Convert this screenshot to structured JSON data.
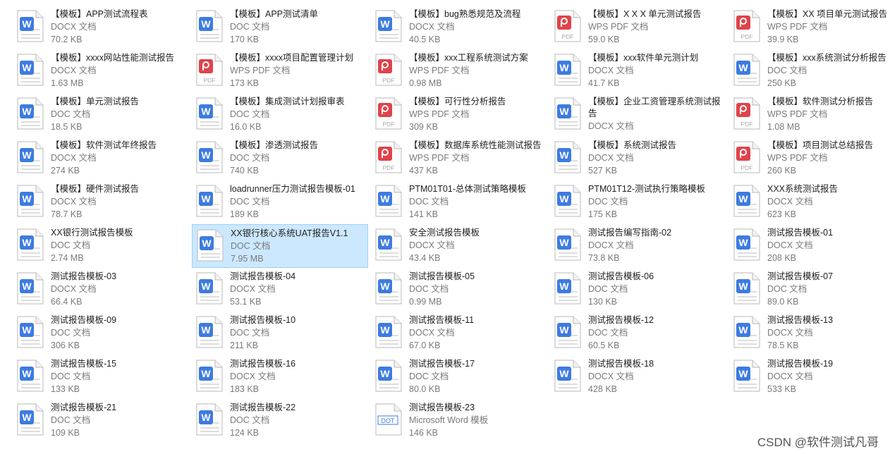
{
  "files": [
    {
      "name": "【模板】APP测试流程表",
      "type": "DOCX 文档",
      "size": "70.2 KB",
      "icon": "word-icon"
    },
    {
      "name": "【模板】APP测试清单",
      "type": "DOC 文档",
      "size": "170 KB",
      "icon": "word-icon"
    },
    {
      "name": "【模板】bug熟悉规范及流程",
      "type": "DOCX 文档",
      "size": "40.5 KB",
      "icon": "word-icon"
    },
    {
      "name": "【模板】X X X 单元测试报告",
      "type": "WPS PDF 文档",
      "size": "59.0 KB",
      "icon": "pdf-icon"
    },
    {
      "name": "【模板】XX 项目单元测试报告",
      "type": "WPS PDF 文档",
      "size": "39.9 KB",
      "icon": "pdf-icon"
    },
    {
      "name": "【模板】xxxx网站性能测试报告",
      "type": "DOCX 文档",
      "size": "1.63 MB",
      "icon": "word-icon"
    },
    {
      "name": "【模板】xxxx项目配置管理计划",
      "type": "WPS PDF 文档",
      "size": "173 KB",
      "icon": "pdf-icon"
    },
    {
      "name": "【模板】xxx工程系统测试方案",
      "type": "WPS PDF 文档",
      "size": "0.98 MB",
      "icon": "pdf-icon"
    },
    {
      "name": "【模板】xxx软件单元测计划",
      "type": "DOCX 文档",
      "size": "41.7 KB",
      "icon": "word-icon"
    },
    {
      "name": "【模板】xxx系统测试分析报告",
      "type": "DOC 文档",
      "size": "250 KB",
      "icon": "word-icon"
    },
    {
      "name": "【模板】单元测试报告",
      "type": "DOC 文档",
      "size": "18.5 KB",
      "icon": "word-icon"
    },
    {
      "name": "【模板】集成测试计划报审表",
      "type": "DOC 文档",
      "size": "16.0 KB",
      "icon": "word-icon"
    },
    {
      "name": "【模板】可行性分析报告",
      "type": "WPS PDF 文档",
      "size": "309 KB",
      "icon": "pdf-icon"
    },
    {
      "name": "【模板】企业工资管理系统测试报告",
      "type": "DOCX 文档",
      "size": "",
      "icon": "word-icon",
      "wrap": true
    },
    {
      "name": "【模板】软件测试分析报告",
      "type": "WPS PDF 文档",
      "size": "1.08 MB",
      "icon": "pdf-icon"
    },
    {
      "name": "【模板】软件测试年终报告",
      "type": "DOCX 文档",
      "size": "274 KB",
      "icon": "word-icon"
    },
    {
      "name": "【模板】渗透测试报告",
      "type": "DOC 文档",
      "size": "740 KB",
      "icon": "word-icon"
    },
    {
      "name": "【模板】数据库系统性能测试报告",
      "type": "WPS PDF 文档",
      "size": "437 KB",
      "icon": "pdf-icon"
    },
    {
      "name": "【模板】系统测试报告",
      "type": "DOCX 文档",
      "size": "527 KB",
      "icon": "word-icon"
    },
    {
      "name": "【模板】项目测试总结报告",
      "type": "WPS PDF 文档",
      "size": "260 KB",
      "icon": "pdf-icon"
    },
    {
      "name": "【模板】硬件测试报告",
      "type": "DOCX 文档",
      "size": "78.7 KB",
      "icon": "word-icon"
    },
    {
      "name": "loadrunner压力测试报告模板-01",
      "type": "DOC 文档",
      "size": "189 KB",
      "icon": "word-icon"
    },
    {
      "name": "PTM01T01-总体测试策略模板",
      "type": "DOC 文档",
      "size": "141 KB",
      "icon": "word-icon"
    },
    {
      "name": "PTM01T12-测试执行策略模板",
      "type": "DOC 文档",
      "size": "175 KB",
      "icon": "word-icon"
    },
    {
      "name": "XXX系统测试报告",
      "type": "DOCX 文档",
      "size": "623 KB",
      "icon": "word-icon"
    },
    {
      "name": "XX银行测试报告模板",
      "type": "DOC 文档",
      "size": "2.74 MB",
      "icon": "word-icon"
    },
    {
      "name": "XX银行核心系统UAT报告V1.1",
      "type": "DOC 文档",
      "size": "7.95 MB",
      "icon": "word-icon",
      "selected": true
    },
    {
      "name": "安全测试报告模板",
      "type": "DOCX 文档",
      "size": "43.4 KB",
      "icon": "word-icon"
    },
    {
      "name": "测试报告编写指南-02",
      "type": "DOCX 文档",
      "size": "73.8 KB",
      "icon": "word-icon"
    },
    {
      "name": "测试报告模板-01",
      "type": "DOCX 文档",
      "size": "208 KB",
      "icon": "word-icon"
    },
    {
      "name": "测试报告模板-03",
      "type": "DOCX 文档",
      "size": "66.4 KB",
      "icon": "word-icon"
    },
    {
      "name": "测试报告模板-04",
      "type": "DOCX 文档",
      "size": "53.1 KB",
      "icon": "word-icon"
    },
    {
      "name": "测试报告模板-05",
      "type": "DOC 文档",
      "size": "0.99 MB",
      "icon": "word-icon"
    },
    {
      "name": "测试报告模板-06",
      "type": "DOC 文档",
      "size": "130 KB",
      "icon": "word-icon"
    },
    {
      "name": "测试报告模板-07",
      "type": "DOC 文档",
      "size": "89.0 KB",
      "icon": "word-icon"
    },
    {
      "name": "测试报告模板-09",
      "type": "DOC 文档",
      "size": "306 KB",
      "icon": "word-icon"
    },
    {
      "name": "测试报告模板-10",
      "type": "DOC 文档",
      "size": "211 KB",
      "icon": "word-icon"
    },
    {
      "name": "测试报告模板-11",
      "type": "DOCX 文档",
      "size": "67.0 KB",
      "icon": "word-icon"
    },
    {
      "name": "测试报告模板-12",
      "type": "DOC 文档",
      "size": "60.5 KB",
      "icon": "word-icon"
    },
    {
      "name": "测试报告模板-13",
      "type": "DOCX 文档",
      "size": "78.5 KB",
      "icon": "word-icon"
    },
    {
      "name": "测试报告模板-15",
      "type": "DOC 文档",
      "size": "133 KB",
      "icon": "word-icon"
    },
    {
      "name": "测试报告模板-16",
      "type": "DOCX 文档",
      "size": "183 KB",
      "icon": "word-icon"
    },
    {
      "name": "测试报告模板-17",
      "type": "DOC 文档",
      "size": "80.0 KB",
      "icon": "word-icon"
    },
    {
      "name": "测试报告模板-18",
      "type": "DOCX 文档",
      "size": "428 KB",
      "icon": "word-icon"
    },
    {
      "name": "测试报告模板-19",
      "type": "DOCX 文档",
      "size": "533 KB",
      "icon": "word-icon"
    },
    {
      "name": "测试报告模板-21",
      "type": "DOC 文档",
      "size": "109 KB",
      "icon": "word-icon"
    },
    {
      "name": "测试报告模板-22",
      "type": "DOC 文档",
      "size": "124 KB",
      "icon": "word-icon"
    },
    {
      "name": "测试报告模板-23",
      "type": "Microsoft Word 模板",
      "size": "146 KB",
      "icon": "dot-icon",
      "icon_label": "DOT"
    }
  ],
  "icon_labels": {
    "pdf": "PDF",
    "word": "W"
  },
  "colors": {
    "word_blue": "#3d7be0",
    "pdf_red": "#e0434a",
    "selection_bg": "#cce8ff",
    "selection_border": "#99d1ff"
  },
  "watermark": "CSDN @软件测试凡哥"
}
